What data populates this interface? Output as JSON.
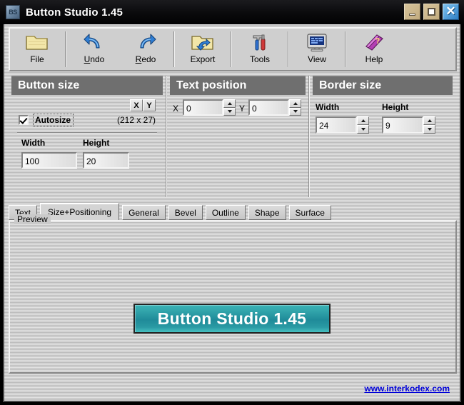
{
  "titlebar": {
    "icon": "app-icon-bs",
    "icon_text": "BS",
    "title": "Button Studio 1.45",
    "minimize_label": "Minimize",
    "maximize_label": "Maximize",
    "close_label": "Close"
  },
  "toolbar": {
    "items": [
      {
        "label": "File",
        "icon": "folder-icon",
        "accel": ""
      },
      {
        "label": "Undo",
        "icon": "undo-arrow-icon",
        "accel": "U"
      },
      {
        "label": "Redo",
        "icon": "redo-arrow-icon",
        "accel": "R"
      },
      {
        "label": "Export",
        "icon": "export-folder-icon",
        "accel": ""
      },
      {
        "label": "Tools",
        "icon": "tools-icon",
        "accel": ""
      },
      {
        "label": "View",
        "icon": "monitor-icon",
        "accel": ""
      },
      {
        "label": "Help",
        "icon": "help-book-icon",
        "accel": ""
      }
    ]
  },
  "button_size": {
    "header": "Button size",
    "autosize_label": "Autosize",
    "autosize_checked": true,
    "x_button": "X",
    "y_button": "Y",
    "measured": "(212 x 27)",
    "width_label": "Width",
    "width_value": "100",
    "height_label": "Height",
    "height_value": "20"
  },
  "text_position": {
    "header": "Text position",
    "x_label": "X",
    "x_value": "0",
    "y_label": "Y",
    "y_value": "0"
  },
  "border_size": {
    "header": "Border size",
    "width_label": "Width",
    "width_value": "24",
    "height_label": "Height",
    "height_value": "9"
  },
  "tabs": {
    "active": "Size+Positioning",
    "items": [
      "Text",
      "Size+Positioning",
      "General",
      "Bevel",
      "Outline",
      "Shape",
      "Surface"
    ]
  },
  "preview": {
    "group_label": "Preview",
    "button_text": "Button Studio 1.45"
  },
  "footer": {
    "link_text": "www.interkodex.com"
  },
  "colors": {
    "titlebar_bg": "#0a0a0c",
    "panel_header_bg": "#6f6f6f",
    "window_bg": "#c8c8c8",
    "preview_button_teal_light": "#3ab3b6",
    "preview_button_teal_dark": "#1f8b99",
    "link_blue": "#0000d8",
    "close_button_blue": "#2f7fc4"
  }
}
